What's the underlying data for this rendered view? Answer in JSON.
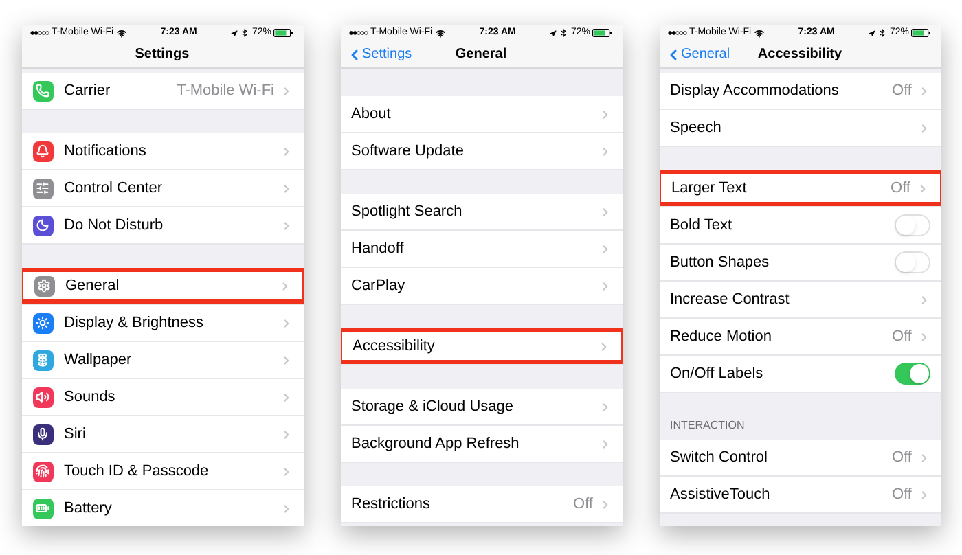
{
  "screens": [
    {
      "status": {
        "carrier": "T-Mobile Wi-Fi",
        "time": "7:23 AM",
        "battery": "72%"
      },
      "nav": {
        "title": "Settings"
      },
      "items": [
        {
          "kind": "row",
          "label": "Carrier",
          "value": "T-Mobile Wi-Fi",
          "highlighted": false,
          "color": "#34c759"
        },
        {
          "kind": "gap"
        },
        {
          "kind": "row",
          "label": "Notifications",
          "highlighted": false,
          "color": "#f2383a"
        },
        {
          "kind": "row",
          "label": "Control Center",
          "highlighted": false,
          "color": "#8e8e93"
        },
        {
          "kind": "row",
          "label": "Do Not Disturb",
          "highlighted": false,
          "color": "#5b4fd6"
        },
        {
          "kind": "gap"
        },
        {
          "kind": "row",
          "label": "General",
          "highlighted": true,
          "color": "#8e8e93"
        },
        {
          "kind": "row",
          "label": "Display & Brightness",
          "highlighted": false,
          "color": "#1a7ef5"
        },
        {
          "kind": "row",
          "label": "Wallpaper",
          "highlighted": false,
          "color": "#2fa8e0"
        },
        {
          "kind": "row",
          "label": "Sounds",
          "highlighted": false,
          "color": "#f2385a"
        },
        {
          "kind": "row",
          "label": "Siri",
          "highlighted": false,
          "color": "#3a2f7a"
        },
        {
          "kind": "row",
          "label": "Touch ID & Passcode",
          "highlighted": false,
          "color": "#f2385a"
        },
        {
          "kind": "row",
          "label": "Battery",
          "highlighted": false,
          "color": "#34c759"
        }
      ]
    },
    {
      "status": {
        "carrier": "T-Mobile Wi-Fi",
        "time": "7:23 AM",
        "battery": "72%"
      },
      "nav": {
        "back": "Settings",
        "title": "General"
      },
      "items": [
        {
          "kind": "gap"
        },
        {
          "kind": "row",
          "label": "About",
          "highlighted": false
        },
        {
          "kind": "row",
          "label": "Software Update",
          "highlighted": false
        },
        {
          "kind": "gap"
        },
        {
          "kind": "row",
          "label": "Spotlight Search",
          "highlighted": false
        },
        {
          "kind": "row",
          "label": "Handoff",
          "highlighted": false
        },
        {
          "kind": "row",
          "label": "CarPlay",
          "highlighted": false
        },
        {
          "kind": "gap"
        },
        {
          "kind": "row",
          "label": "Accessibility",
          "highlighted": true
        },
        {
          "kind": "gap"
        },
        {
          "kind": "row",
          "label": "Storage & iCloud Usage",
          "highlighted": false
        },
        {
          "kind": "row",
          "label": "Background App Refresh",
          "highlighted": false
        },
        {
          "kind": "gap"
        },
        {
          "kind": "row",
          "label": "Restrictions",
          "value": "Off",
          "highlighted": false
        }
      ]
    },
    {
      "status": {
        "carrier": "T-Mobile Wi-Fi",
        "time": "7:23 AM",
        "battery": "72%"
      },
      "nav": {
        "back": "General",
        "title": "Accessibility"
      },
      "items": [
        {
          "kind": "row",
          "label": "Display Accommodations",
          "value": "Off",
          "highlighted": false
        },
        {
          "kind": "row",
          "label": "Speech",
          "highlighted": false
        },
        {
          "kind": "gap"
        },
        {
          "kind": "row",
          "label": "Larger Text",
          "value": "Off",
          "highlighted": true
        },
        {
          "kind": "toggle",
          "label": "Bold Text",
          "on": false
        },
        {
          "kind": "toggle",
          "label": "Button Shapes",
          "on": false
        },
        {
          "kind": "row",
          "label": "Increase Contrast",
          "highlighted": false
        },
        {
          "kind": "row",
          "label": "Reduce Motion",
          "value": "Off",
          "highlighted": false
        },
        {
          "kind": "toggle",
          "label": "On/Off Labels",
          "on": true
        },
        {
          "kind": "header",
          "label": "INTERACTION"
        },
        {
          "kind": "row",
          "label": "Switch Control",
          "value": "Off",
          "highlighted": false
        },
        {
          "kind": "row",
          "label": "AssistiveTouch",
          "value": "Off",
          "highlighted": false
        }
      ]
    }
  ]
}
